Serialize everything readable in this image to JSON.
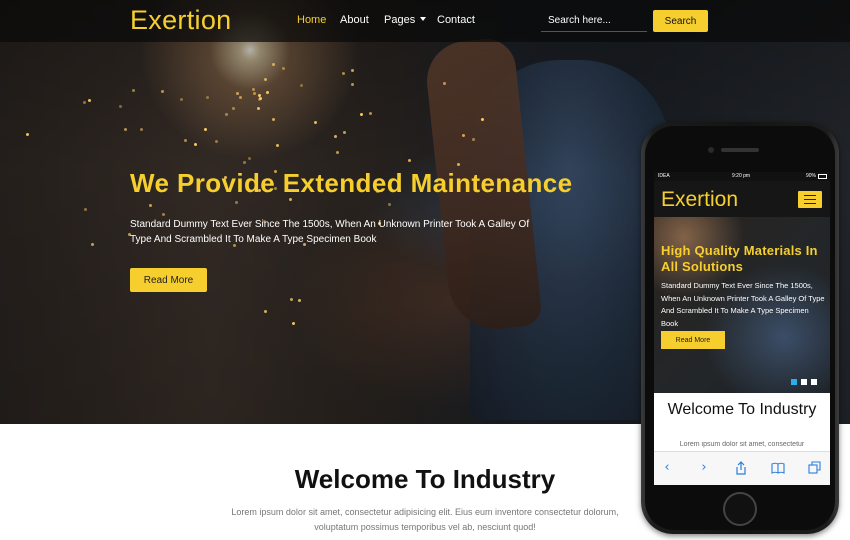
{
  "nav": {
    "brand": "Exertion",
    "links": [
      {
        "label": "Home",
        "active": true
      },
      {
        "label": "About"
      },
      {
        "label": "Pages"
      },
      {
        "label": "Contact"
      }
    ],
    "search_placeholder": "Search here...",
    "search_button": "Search"
  },
  "hero": {
    "title": "We Provide Extended Maintenance",
    "description": "Standard Dummy Text Ever Since The 1500s, When An Unknown Printer Took A Galley Of Type And Scrambled It To Make A Type Specimen Book",
    "button": "Read More"
  },
  "welcome": {
    "title": "Welcome To Industry",
    "text": "Lorem ipsum dolor sit amet, consectetur adipisicing elit. Eius eum inventore consectetur dolorum, voluptatum possimus temporibus vel ab, nesciunt quod!"
  },
  "mobile": {
    "status": {
      "carrier": "IDEA",
      "time": "9:20 pm",
      "battery": "90%"
    },
    "brand": "Exertion",
    "hero_title": "High Quality Materials In All Solutions",
    "hero_description": "Standard Dummy Text Ever Since The 1500s, When An Unknown Printer Took A Galley Of Type And Scrambled It To Make A Type Specimen Book",
    "button": "Read More",
    "welcome_title": "Welcome To Industry",
    "welcome_text": "Lorem ipsum dolor sit amet, consectetur",
    "toolbar_icons": [
      "back-icon",
      "forward-icon",
      "share-icon",
      "bookmarks-icon",
      "tabs-icon"
    ]
  },
  "colors": {
    "accent": "#f6cf2f",
    "slider_active": "#2ab0e6"
  }
}
